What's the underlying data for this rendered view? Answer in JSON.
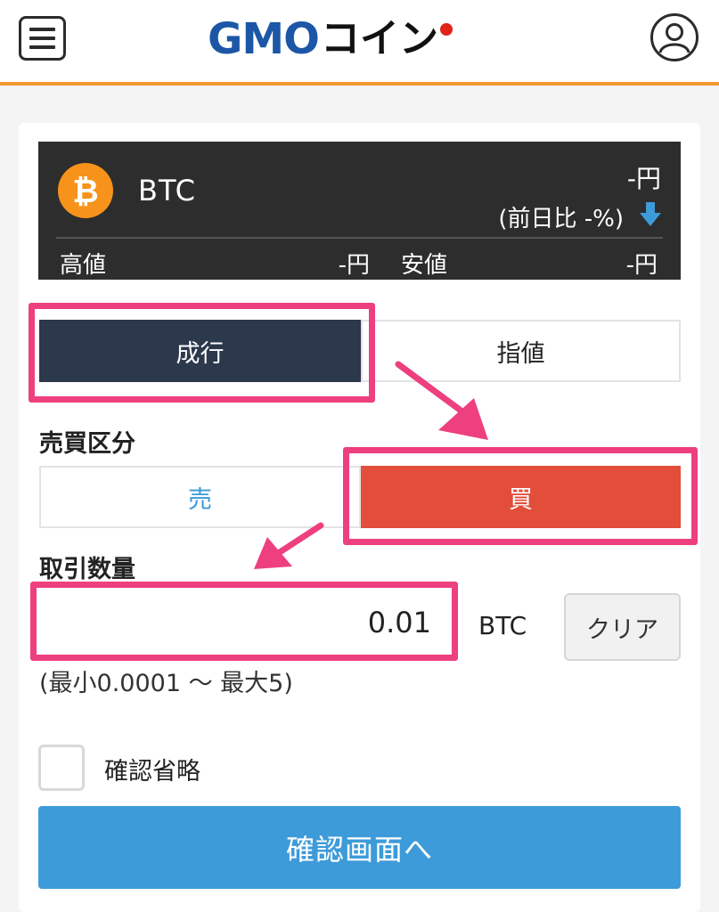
{
  "header": {
    "logo_brand": "GMO",
    "logo_suffix": "コイン"
  },
  "ticker": {
    "symbol": "BTC",
    "price": "-円",
    "change": "(前日比 -%)",
    "high_label": "高値",
    "high_value": "-円",
    "low_label": "安値",
    "low_value": "-円"
  },
  "order_type": {
    "market_label": "成行",
    "limit_label": "指値",
    "selected": "成行"
  },
  "side": {
    "section_label": "売買区分",
    "sell_label": "売",
    "buy_label": "買",
    "selected": "買"
  },
  "quantity": {
    "section_label": "取引数量",
    "value": "0.01",
    "unit": "BTC",
    "clear_label": "クリア",
    "range_text": "(最小0.0001 〜 最大5)"
  },
  "skip_confirm": {
    "label": "確認省略",
    "checked": false
  },
  "confirm_button": {
    "label": "確認画面へ"
  },
  "colors": {
    "header_accent": "#f29a2e",
    "logo_blue": "#1b57a6",
    "selected_order_type": "#2c384c",
    "buy": "#e24e3a",
    "sell_text": "#3a9ad8",
    "confirm": "#3e9bd9",
    "highlight": "#ee3f7e"
  }
}
